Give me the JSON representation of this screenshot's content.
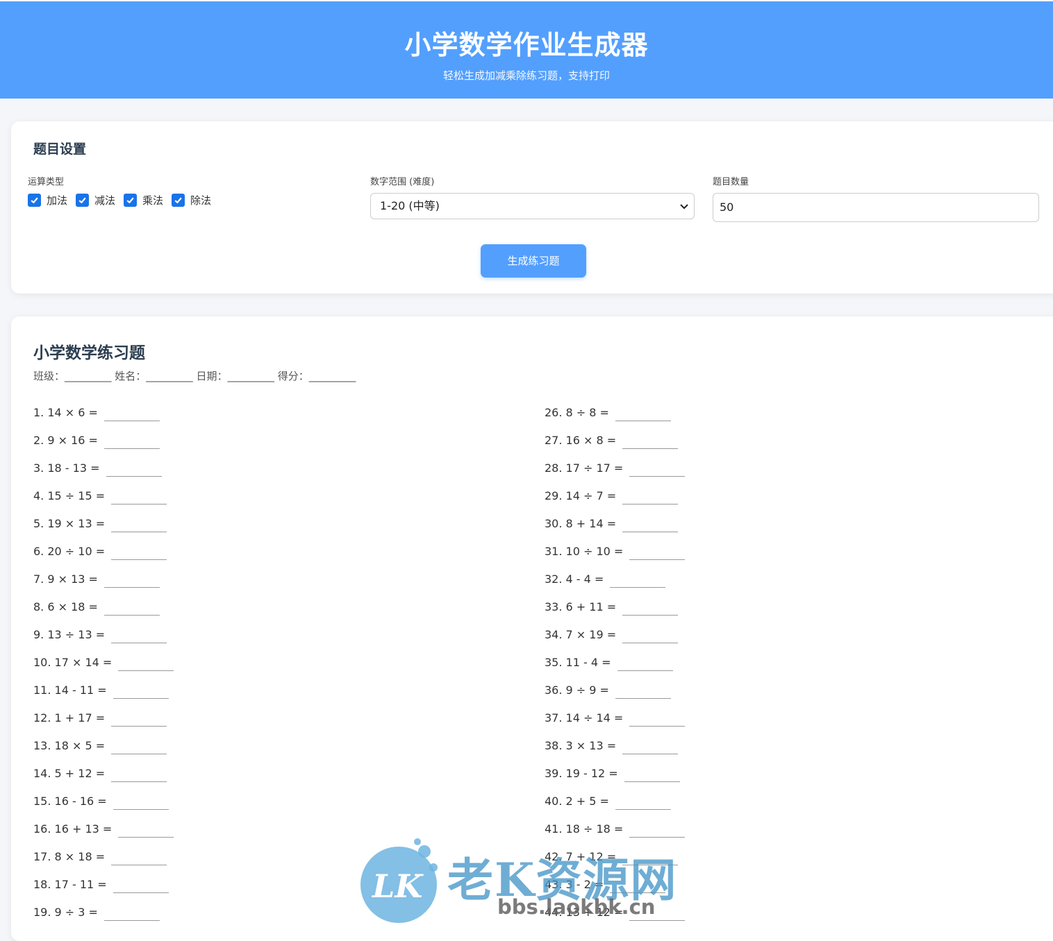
{
  "header": {
    "title": "小学数学作业生成器",
    "subtitle": "轻松生成加减乘除练习题，支持打印"
  },
  "settings": {
    "title": "题目设置",
    "op_label": "运算类型",
    "ops": [
      {
        "label": "加法",
        "checked": true
      },
      {
        "label": "减法",
        "checked": true
      },
      {
        "label": "乘法",
        "checked": true
      },
      {
        "label": "除法",
        "checked": true
      }
    ],
    "range_label": "数字范围 (难度)",
    "range_value": "1-20 (中等)",
    "count_label": "题目数量",
    "count_value": "50",
    "generate_label": "生成练习题"
  },
  "sheet": {
    "title": "小学数学练习题",
    "info": "班级：_________ 姓名：_________ 日期：_________ 得分：_________",
    "left": [
      "1. 14 × 6 =",
      "2. 9 × 16 =",
      "3. 18 - 13 =",
      "4. 15 ÷ 15 =",
      "5. 19 × 13 =",
      "6. 20 ÷ 10 =",
      "7. 9 × 13 =",
      "8. 6 × 18 =",
      "9. 13 ÷ 13 =",
      "10. 17 × 14 =",
      "11. 14 - 11 =",
      "12. 1 + 17 =",
      "13. 18 × 5 =",
      "14. 5 + 12 =",
      "15. 16 - 16 =",
      "16. 16 + 13 =",
      "17. 8 × 18 =",
      "18. 17 - 11 =",
      "19. 9 ÷ 3 ="
    ],
    "right": [
      "26. 8 ÷ 8 =",
      "27. 16 × 8 =",
      "28. 17 ÷ 17 =",
      "29. 14 ÷ 7 =",
      "30. 8 + 14 =",
      "31. 10 ÷ 10 =",
      "32. 4 - 4 =",
      "33. 6 + 11 =",
      "34. 7 × 19 =",
      "35. 11 - 4 =",
      "36. 9 ÷ 9 =",
      "37. 14 ÷ 14 =",
      "38. 3 × 13 =",
      "39. 19 - 12 =",
      "40. 2 + 5 =",
      "41. 18 ÷ 18 =",
      "42. 7 + 12 =",
      "43. 3 - 2 =",
      "44. 13 + 12 ="
    ]
  },
  "watermark": {
    "logo_text": "LK",
    "site_name": "老K资源网",
    "url": "bbs.laokbk.cn"
  },
  "colors": {
    "header_bg": "#539ffe",
    "checkbox": "#1a73e8"
  }
}
